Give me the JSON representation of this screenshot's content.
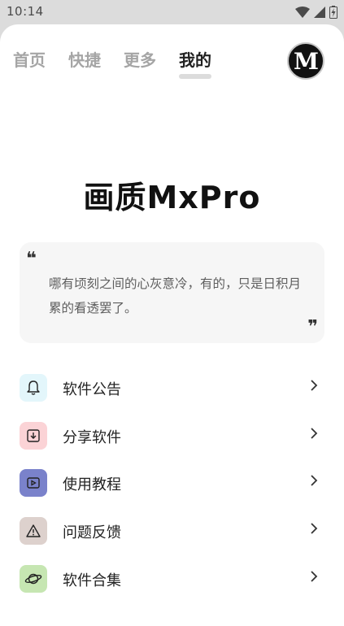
{
  "status_bar": {
    "time": "10:14"
  },
  "tabs": [
    {
      "label": "首页",
      "active": false
    },
    {
      "label": "快捷",
      "active": false
    },
    {
      "label": "更多",
      "active": false
    },
    {
      "label": "我的",
      "active": true
    }
  ],
  "avatar": {
    "letter": "M"
  },
  "app_title": "画质MxPro",
  "quote": {
    "text": "哪有顷刻之间的心灰意冷，有的，只是日积月累的看透罢了。"
  },
  "menu": [
    {
      "label": "软件公告",
      "icon": "bell-icon",
      "color": "#e3f6fb"
    },
    {
      "label": "分享软件",
      "icon": "download-box-icon",
      "color": "#fbd3d6"
    },
    {
      "label": "使用教程",
      "icon": "play-video-icon",
      "color": "#7a82cb"
    },
    {
      "label": "问题反馈",
      "icon": "warning-icon",
      "color": "#ddd1cd"
    },
    {
      "label": "软件合集",
      "icon": "planet-icon",
      "color": "#c6e6b2"
    }
  ]
}
